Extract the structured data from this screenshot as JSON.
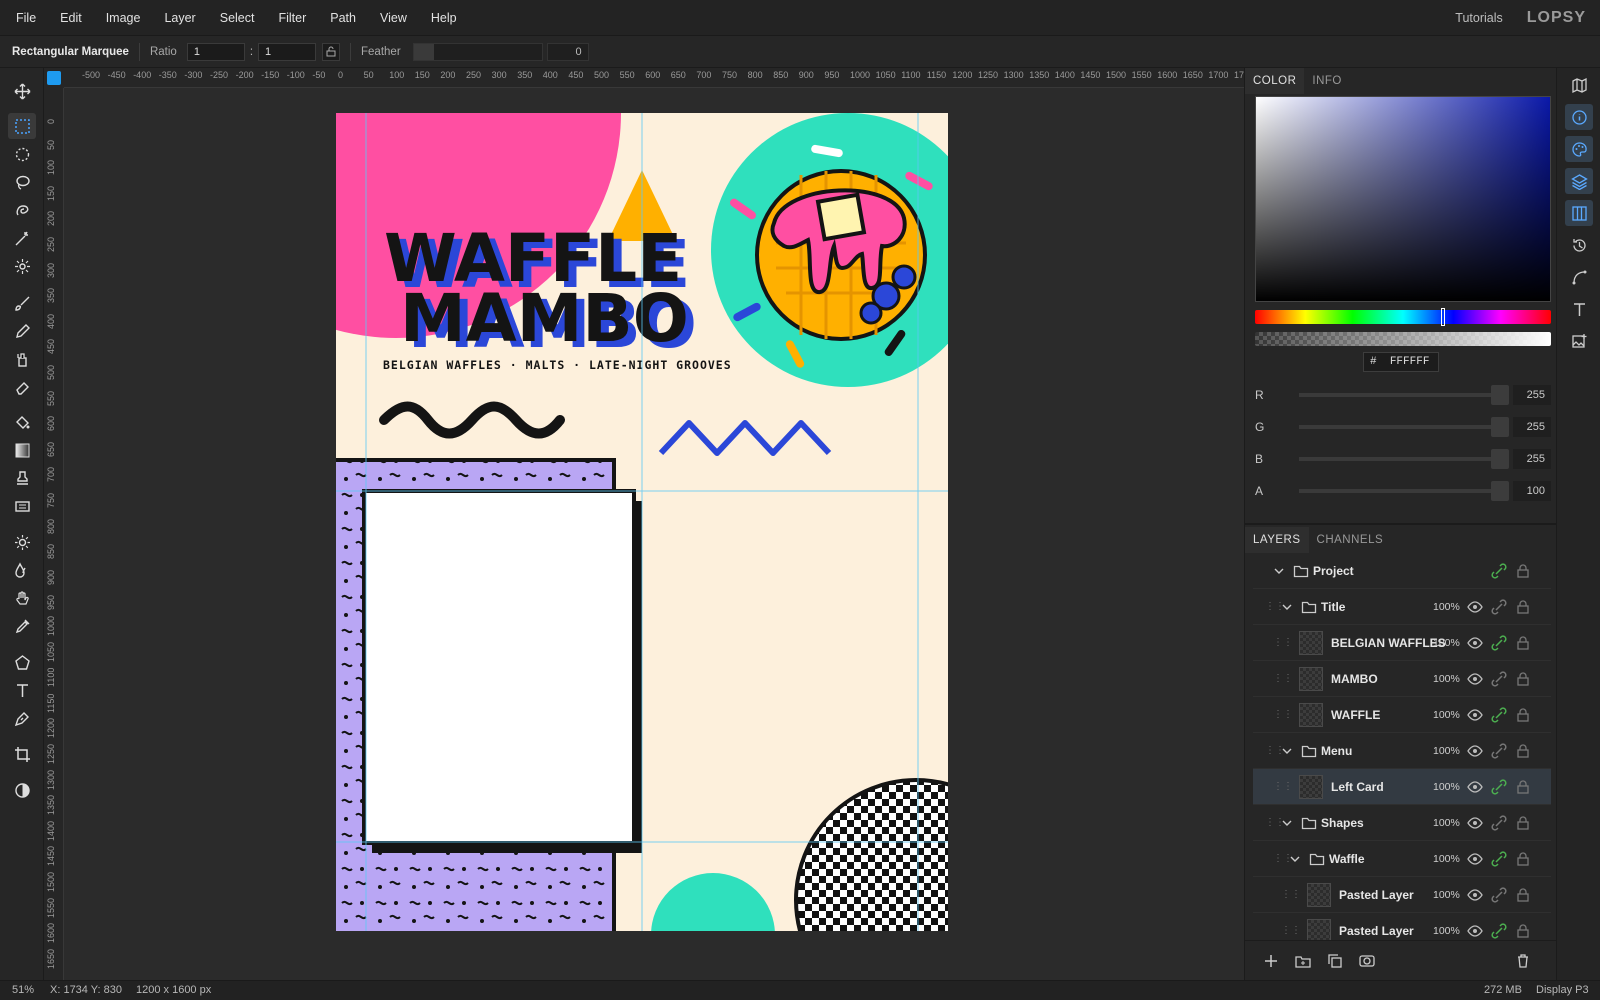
{
  "menubar": {
    "menus": [
      "File",
      "Edit",
      "Image",
      "Layer",
      "Select",
      "Filter",
      "Path",
      "View",
      "Help"
    ],
    "tutorials": "Tutorials",
    "brand": "LOPSY"
  },
  "options": {
    "tool_name": "Rectangular Marquee",
    "ratio_label": "Ratio",
    "ratio_w": "1",
    "ratio_sep": ":",
    "ratio_h": "1",
    "feather_label": "Feather",
    "feather_value": "0"
  },
  "rulers": {
    "top": [
      "-500",
      "-450",
      "-400",
      "-350",
      "-300",
      "-250",
      "-200",
      "-150",
      "-100",
      "-50",
      "0",
      "50",
      "100",
      "150",
      "200",
      "250",
      "300",
      "350",
      "400",
      "450",
      "500",
      "550",
      "600",
      "650",
      "700",
      "750",
      "800",
      "850",
      "900",
      "950",
      "1000",
      "1050",
      "1100",
      "1150",
      "1200",
      "1250",
      "1300",
      "1350",
      "1400",
      "1450",
      "1500",
      "1550",
      "1600",
      "1650",
      "1700",
      "17"
    ],
    "left": [
      "0",
      "50",
      "100",
      "150",
      "200",
      "250",
      "300",
      "350",
      "400",
      "450",
      "500",
      "550",
      "600",
      "650",
      "700",
      "750",
      "800",
      "850",
      "900",
      "950",
      "1000",
      "1050",
      "1100",
      "1150",
      "1200",
      "1250",
      "1300",
      "1350",
      "1400",
      "1450",
      "1500",
      "1550",
      "1600",
      "1650"
    ]
  },
  "poster": {
    "title_line1": "WAFFLE",
    "title_line2": "MAMBO",
    "tagline": "BELGIAN WAFFLES · MALTS · LATE-NIGHT GROOVES",
    "colors": {
      "background": "#fdf0dc",
      "pink": "#ff4fa2",
      "teal": "#2fe0bd",
      "yellow": "#ffb000",
      "blue": "#2b47d8",
      "purple": "#b9a6f4",
      "ink": "#141414"
    }
  },
  "status": {
    "zoom": "51%",
    "coords": "X: 1734  Y: 830",
    "doc_size": "1200 x 1600 px",
    "memory": "272 MB",
    "profile": "Display P3"
  },
  "color_panel": {
    "tabs": [
      "COLOR",
      "INFO"
    ],
    "hex_prefix": "#",
    "hex": "FFFFFF",
    "channels": [
      {
        "label": "R",
        "value": "255"
      },
      {
        "label": "G",
        "value": "255"
      },
      {
        "label": "B",
        "value": "255"
      },
      {
        "label": "A",
        "value": "100"
      }
    ]
  },
  "layers_panel": {
    "tabs": [
      "LAYERS",
      "CHANNELS"
    ],
    "rows": [
      {
        "name": "Project",
        "type": "folder",
        "opacity": "",
        "depth": 0
      },
      {
        "name": "Title",
        "type": "folder",
        "opacity": "100%",
        "depth": 1
      },
      {
        "name": "BELGIAN WAFFLES",
        "type": "layer",
        "opacity": "100%",
        "depth": 2
      },
      {
        "name": "MAMBO",
        "type": "layer",
        "opacity": "100%",
        "depth": 2
      },
      {
        "name": "WAFFLE",
        "type": "layer",
        "opacity": "100%",
        "depth": 2
      },
      {
        "name": "Menu",
        "type": "folder",
        "opacity": "100%",
        "depth": 1
      },
      {
        "name": "Left Card",
        "type": "layer",
        "opacity": "100%",
        "depth": 2,
        "selected": true
      },
      {
        "name": "Shapes",
        "type": "folder",
        "opacity": "100%",
        "depth": 1
      },
      {
        "name": "Waffle",
        "type": "folder",
        "opacity": "100%",
        "depth": 2
      },
      {
        "name": "Pasted Layer",
        "type": "layer",
        "opacity": "100%",
        "depth": 3
      },
      {
        "name": "Pasted Layer",
        "type": "layer",
        "opacity": "100%",
        "depth": 3
      }
    ]
  },
  "icons": {
    "tools": [
      "move-icon",
      "rect-marquee-icon",
      "ellipse-marquee-icon",
      "lasso-icon",
      "quick-select-icon",
      "magic-wand-icon",
      "spot-heal-icon",
      "brush-icon",
      "pencil-icon",
      "clone-icon",
      "eraser-icon",
      "bucket-icon",
      "gradient-icon",
      "stamp-icon",
      "eraser-block-icon",
      "dodge-icon",
      "blur-icon",
      "hand-icon",
      "eyedropper-icon",
      "polygon-icon",
      "text-icon",
      "pen-icon",
      "crop-icon",
      "contrast-icon"
    ],
    "rail": [
      "map-icon",
      "info-icon",
      "palette-icon",
      "layers-icon",
      "columns-icon",
      "history-icon",
      "path-icon",
      "type-icon",
      "image-plus-icon"
    ]
  }
}
